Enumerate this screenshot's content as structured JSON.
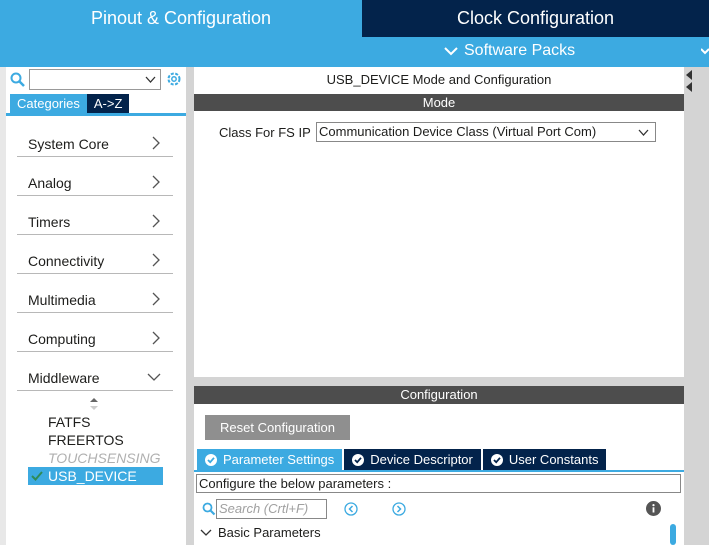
{
  "top_tabs": {
    "pinout_label": "Pinout & Configuration",
    "clock_label": "Clock Configuration"
  },
  "subbar": {
    "software_packs_label": "Software Packs"
  },
  "left_panel": {
    "search": {
      "value": ""
    },
    "tabs": {
      "categories_label": "Categories",
      "az_label": "A->Z"
    },
    "categories": [
      {
        "label": "System Core"
      },
      {
        "label": "Analog"
      },
      {
        "label": "Timers"
      },
      {
        "label": "Connectivity"
      },
      {
        "label": "Multimedia"
      },
      {
        "label": "Computing"
      },
      {
        "label": "Middleware"
      }
    ],
    "middleware_items": [
      {
        "label": "FATFS",
        "state": "normal"
      },
      {
        "label": "FREERTOS",
        "state": "normal"
      },
      {
        "label": "TOUCHSENSING",
        "state": "disabled"
      },
      {
        "label": "USB_DEVICE",
        "state": "selected"
      }
    ]
  },
  "mode_panel": {
    "title": "USB_DEVICE Mode and Configuration",
    "section_label": "Mode",
    "class_label": "Class For FS IP",
    "class_value": "Communication Device Class (Virtual Port Com)"
  },
  "config_panel": {
    "section_label": "Configuration",
    "reset_label": "Reset Configuration",
    "tabs": [
      {
        "label": "Parameter Settings"
      },
      {
        "label": "Device Descriptor"
      },
      {
        "label": "User Constants"
      }
    ],
    "hint": "Configure the below parameters :",
    "search_placeholder": "Search (Crtl+F)",
    "basic_parameters_label": "Basic Parameters"
  },
  "colors": {
    "accent": "#3caae1",
    "navy": "#03234b",
    "bar_gray": "#4d4d4d"
  }
}
